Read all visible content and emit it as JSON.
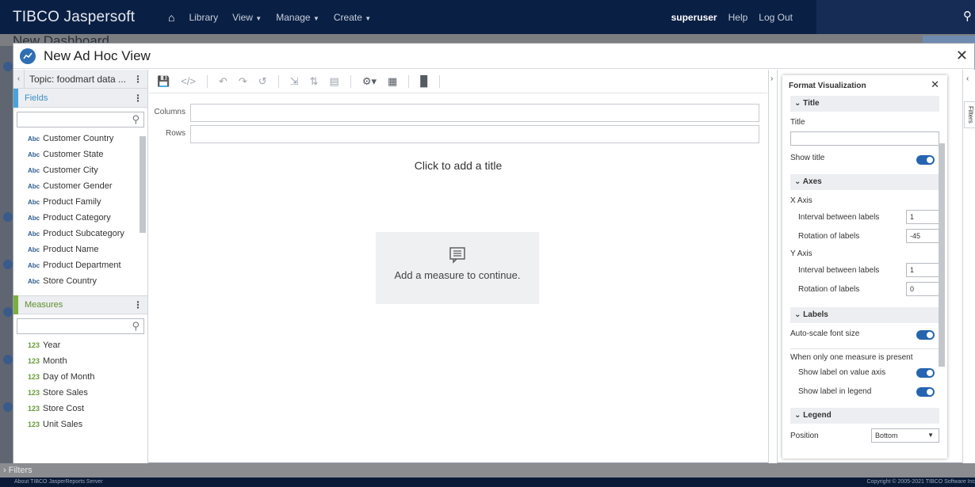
{
  "nav": {
    "logo": "TIBCO Jaspersoft",
    "items": [
      "Library",
      "View",
      "Manage",
      "Create"
    ],
    "user": "superuser",
    "help": "Help",
    "logout": "Log Out"
  },
  "background": {
    "dashboard_title": "New Dashboard",
    "bottom_filters": "Filters",
    "footer_left": "About TIBCO JasperReports Server",
    "footer_right": "Copyright © 2005-2021 TIBCO Software Inc"
  },
  "dialog": {
    "title": "New Ad Hoc View",
    "topic": "Topic: foodmart data ...",
    "fields_label": "Fields",
    "fields": [
      "Customer Country",
      "Customer State",
      "Customer City",
      "Customer Gender",
      "Product Family",
      "Product Category",
      "Product Subcategory",
      "Product Name",
      "Product Department",
      "Store Country"
    ],
    "field_type_tag": "Abc",
    "measures_label": "Measures",
    "measure_type_tag": "123",
    "measures": [
      "Year",
      "Month",
      "Day of Month",
      "Store Sales",
      "Store Cost",
      "Unit Sales"
    ],
    "columns_label": "Columns",
    "rows_label": "Rows",
    "canvas_title": "Click to add a title",
    "measure_prompt": "Add a measure to continue."
  },
  "format_panel": {
    "header": "Format Visualization",
    "sections": {
      "title": "Title",
      "axes": "Axes",
      "labels": "Labels",
      "legend": "Legend"
    },
    "title_field_label": "Title",
    "title_value": "",
    "show_title": "Show title",
    "x_axis": "X Axis",
    "y_axis": "Y Axis",
    "interval_label": "Interval between labels",
    "rotation_label": "Rotation of labels",
    "x_interval": "1",
    "x_rotation": "-45",
    "y_interval": "1",
    "y_rotation": "0",
    "auto_scale": "Auto-scale font size",
    "one_measure": "When only one measure is present",
    "label_value_axis": "Show label on value axis",
    "label_legend": "Show label in legend",
    "position_label": "Position",
    "position_value": "Bottom"
  },
  "filters_tab": "Filters",
  "colors": {
    "nav_bg": "#0a1f44",
    "fields_accent": "#4aa3d9",
    "measures_accent": "#7ab03b",
    "toggle_on": "#2564b0"
  }
}
